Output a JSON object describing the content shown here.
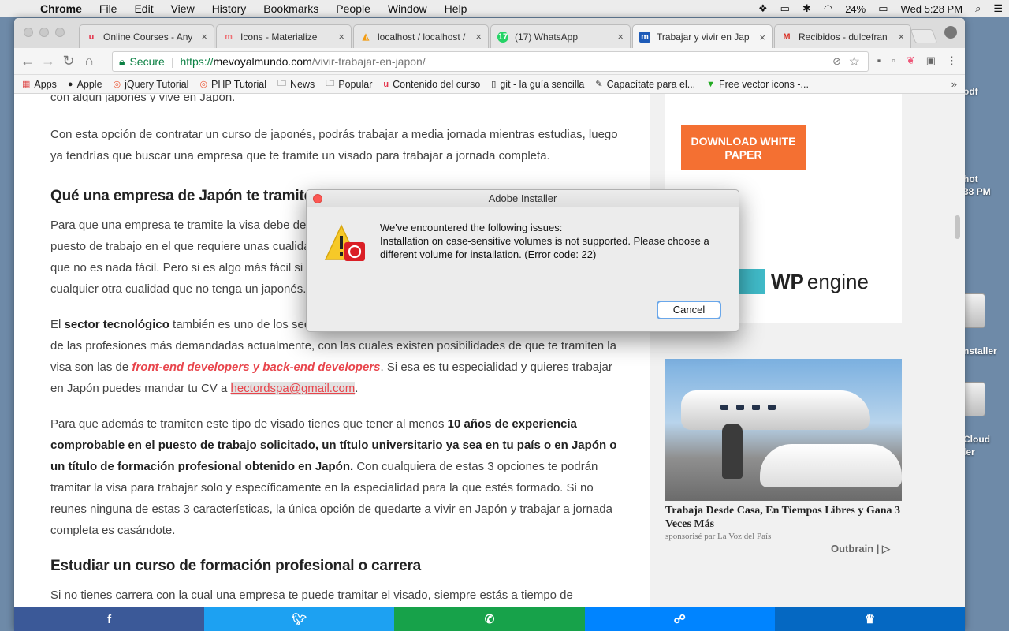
{
  "menubar": {
    "app": "Chrome",
    "items": [
      "File",
      "Edit",
      "View",
      "History",
      "Bookmarks",
      "People",
      "Window",
      "Help"
    ],
    "battery": "24%",
    "clock": "Wed 5:28 PM"
  },
  "desktop": {
    "labels": [
      "odf",
      "hot",
      "38 PM",
      "nstaller",
      "Cloud",
      "ler"
    ]
  },
  "tabs": [
    {
      "title": "Online Courses - Any",
      "favicon": "udemy-icon",
      "color": "#e4344b"
    },
    {
      "title": "Icons - Materialize",
      "favicon": "materialize-icon",
      "color": "#ee6e73"
    },
    {
      "title": "localhost / localhost /",
      "favicon": "phpmyadmin-icon",
      "color": "#f39c12"
    },
    {
      "title": "(17) WhatsApp",
      "favicon": "whatsapp-icon",
      "color": "#25d366"
    },
    {
      "title": "Trabajar y vivir en Jap",
      "favicon": "mevoyalmundo-icon",
      "color": "#1e5bb8"
    },
    {
      "title": "Recibidos - dulcefran",
      "favicon": "gmail-icon",
      "color": "#d93025"
    }
  ],
  "address": {
    "secure_label": "Secure",
    "scheme": "https://",
    "host": "mevoyalmundo.com",
    "path": "/vivir-trabajar-en-japon/"
  },
  "bookmarks": [
    {
      "label": "Apps",
      "icon": "apps-grid-icon"
    },
    {
      "label": "Apple",
      "icon": "apple-icon"
    },
    {
      "label": "jQuery Tutorial",
      "icon": "chrome-icon"
    },
    {
      "label": "PHP Tutorial",
      "icon": "chrome-icon"
    },
    {
      "label": "News",
      "icon": "folder-icon"
    },
    {
      "label": "Popular",
      "icon": "folder-icon"
    },
    {
      "label": "Contenido del curso",
      "icon": "udemy-icon"
    },
    {
      "label": "git - la guía sencilla",
      "icon": "document-icon"
    },
    {
      "label": "Capacítate para el...",
      "icon": "edit-icon"
    },
    {
      "label": "Free vector icons -...",
      "icon": "freepik-icon"
    }
  ],
  "article": {
    "cut_line": "con algún japonés y vive en Japón.",
    "p1": "Con esta opción de contratar un curso de japonés, podrás trabajar a media jornada mientras estudias, luego ya tendrías que buscar una empresa que te tramite un visado para trabajar a jornada completa.",
    "h1": "Qué una empresa de Japón te tramite el visado",
    "p2": "Para que una empresa te tramite la visa debe demostrar que no hay ningún japonés que pueda ocupar el puesto de trabajo en el que requiere unas cualidades o conocimientos que sólo tú puedes aportar, por ello que no es nada fácil. Pero si es algo más fácil si tienes conocimientos como profesor de español o tener cualquier otra cualidad que no tenga un japonés.",
    "p3_a": "El ",
    "p3_b": "sector tecnológico",
    "p3_c": " también es uno de los sectores en los que más se requiere personal extranjero. Una de las profesiones más demandadas actualmente, con las cuales existen posibilidades de que te tramiten la visa son las de ",
    "p3_link": "front-end developers y back-end developers",
    "p3_d": ". Si esa es tu especialidad y quieres trabajar en Japón puedes mandar tu CV a ",
    "p3_mail": " hectordspa@gmail.com",
    "p3_e": ".",
    "p4_a": "Para que además te tramiten este tipo de visado tienes que tener al menos ",
    "p4_b": "10 años de experiencia comprobable en el puesto de trabajo solicitado, un título universitario ya sea en tu país o en Japón o un título de formación profesional obtenido en Japón.",
    "p4_c": " Con cualquiera de estas 3 opciones te podrán tramitar la visa para trabajar solo y específicamente en la especialidad para la que estés formado. Si no reunes ninguna de estas 3 características, la única opción de quedarte a vivir en Japón y trabajar a jornada completa es casándote.",
    "h2": "Estudiar un curso de formación profesional o carrera",
    "p5": "Si no tienes carrera con la cual una empresa te puede tramitar el visado, siempre estás a tiempo de"
  },
  "sidebar": {
    "download_btn": "DOWNLOAD WHITE PAPER",
    "wp_brand_a": "WP",
    "wp_brand_b": "engine",
    "ad_title": "Trabaja Desde Casa, En Tiempos Libres y Gana 3 Veces Más",
    "ad_source": "sponsorisé par La Voz del País",
    "outbrain": "Outbrain | ▷"
  },
  "share": [
    {
      "icon": "facebook-icon",
      "glyph": "f",
      "color": "#3b5998"
    },
    {
      "icon": "twitter-icon",
      "glyph": "🐦",
      "color": "#1da1f2"
    },
    {
      "icon": "whatsapp-icon",
      "glyph": "✆",
      "color": "#17a24a"
    },
    {
      "icon": "messenger-icon",
      "glyph": "☍",
      "color": "#0084ff"
    },
    {
      "icon": "sumo-icon",
      "glyph": "♛",
      "color": "#0568c2"
    }
  ],
  "dialog": {
    "title": "Adobe Installer",
    "line1": "We've encountered the following issues:",
    "line2": "Installation on case-sensitive volumes is not supported. Please choose a different volume for installation. (Error code: 22)",
    "cancel": "Cancel"
  }
}
